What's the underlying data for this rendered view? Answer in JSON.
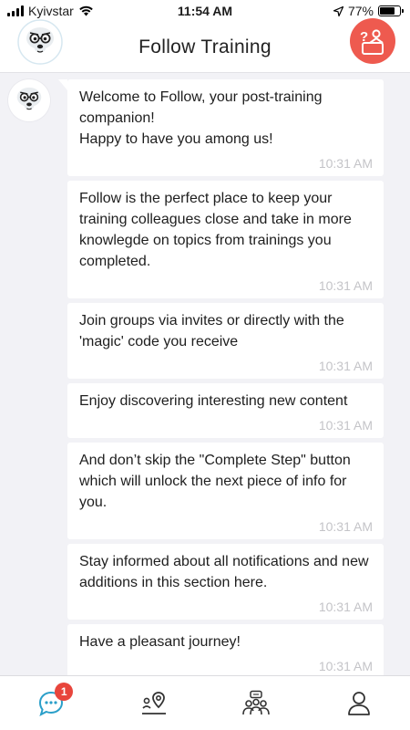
{
  "status_bar": {
    "carrier": "Kyivstar",
    "time": "11:54 AM",
    "battery_percent": "77%",
    "battery_level": 0.77
  },
  "header": {
    "title": "Follow Training",
    "left_icon": "bear-mascot-icon",
    "right_icon": "help-question-icon",
    "help_color": "#ee5a4f"
  },
  "messages": [
    {
      "text": "Welcome to Follow, your post-training companion!\nHappy to have you among us!",
      "time": "10:31 AM"
    },
    {
      "text": "Follow is the perfect place to keep your training colleagues close and take in more knowlegde on topics from trainings you completed.",
      "time": "10:31 AM"
    },
    {
      "text": "Join groups via invites or directly with the 'magic' code you receive",
      "time": "10:31 AM"
    },
    {
      "text": "Enjoy discovering interesting new content",
      "time": "10:31 AM"
    },
    {
      "text": "And don’t skip the \"Complete Step\" button which will unlock the next piece of info for you.",
      "time": "10:31 AM"
    },
    {
      "text": "Stay informed about all notifications and new additions in this section here.",
      "time": "10:31 AM"
    },
    {
      "text": "Have a pleasant journey!",
      "time": "10:31 AM"
    }
  ],
  "tab_bar": {
    "tabs": [
      {
        "icon": "chat-bubble-icon",
        "active": true,
        "badge": "1"
      },
      {
        "icon": "route-pin-icon",
        "active": false
      },
      {
        "icon": "group-icon",
        "active": false
      },
      {
        "icon": "profile-icon",
        "active": false
      }
    ],
    "active_color": "#2a9fc9"
  }
}
